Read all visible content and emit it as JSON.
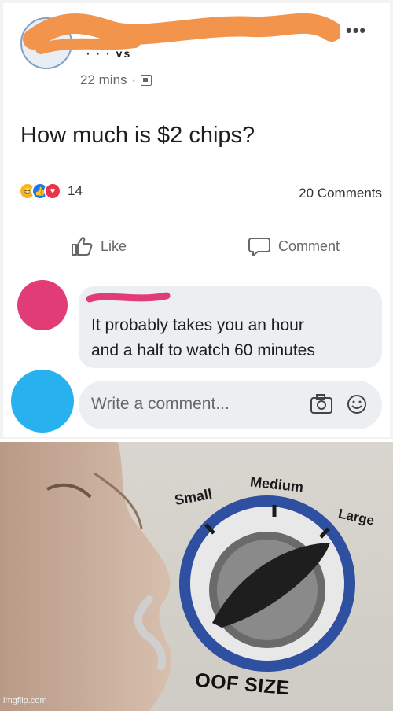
{
  "post": {
    "author_fragment": "· ·  ·  vs",
    "time": "22 mins",
    "separator": "·",
    "text": "How much is $2 chips?",
    "reaction_count": "14",
    "comment_count": "20 Comments",
    "like_label": "Like",
    "comment_label": "Comment"
  },
  "comment": {
    "text_line1": "It probably takes you an hour",
    "text_line2": "and a half to watch 60 minutes"
  },
  "composer": {
    "placeholder": "Write a comment..."
  },
  "meme": {
    "label_small": "Small",
    "label_medium": "Medium",
    "label_large": "Large",
    "label_oof": "OOF SIZE",
    "watermark": "imgflip.com",
    "dial_level": "large"
  },
  "colors": {
    "censor_orange": "#f2944c",
    "censor_pink": "#e23c77",
    "avatar_blue": "#27b2ef",
    "dial_ring": "#2f4fa0"
  }
}
